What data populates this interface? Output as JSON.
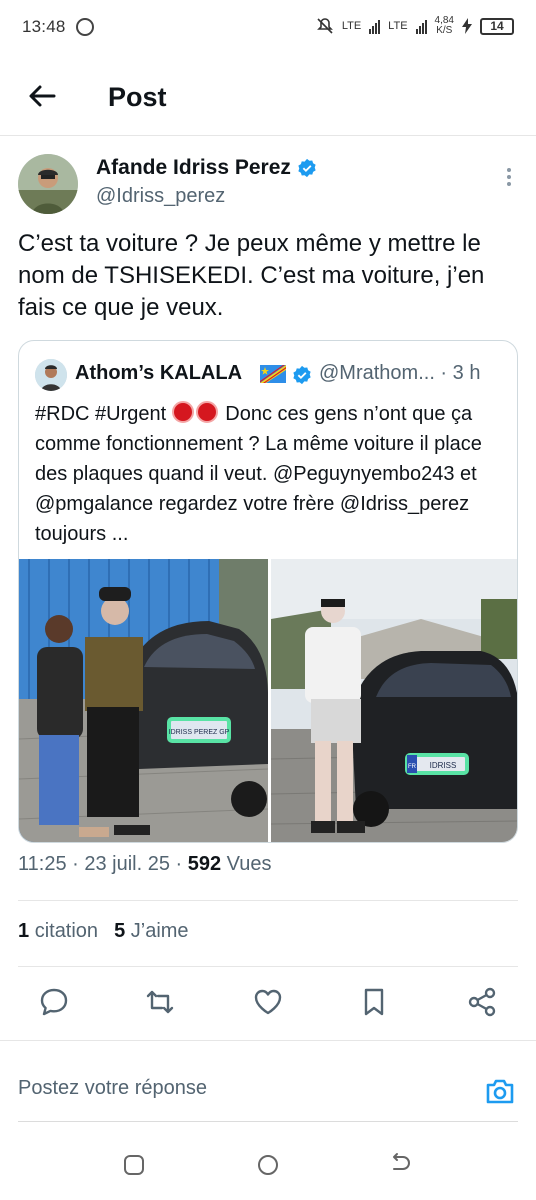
{
  "status_bar": {
    "time": "13:48",
    "net1": "LTE",
    "net2": "LTE",
    "speed_value": "4,84",
    "speed_unit": "K/S",
    "battery": "14"
  },
  "header": {
    "title": "Post"
  },
  "author": {
    "name": "Afande Idriss Perez",
    "handle": "@Idriss_perez"
  },
  "tweet": {
    "text": "C’est ta voiture ? Je peux même y mettre le nom de TSHISEKEDI. C’est ma voiture, j’en fais ce que je veux."
  },
  "quote": {
    "name": "Athom’s KALALA",
    "handle": "@Mrathom... · 3 h",
    "text_hashtags": "#RDC #Urgent",
    "text_body": "Donc ces gens n’ont que ça comme fonctionnement ? La même voiture il place des plaques quand il veut. @Peguynyembo243 et @pmgalance regardez votre frère @Idriss_perez toujours ...",
    "plate1": "IDRISS PEREZ GP",
    "plate2": "IDRISS",
    "plate2_country": "FR"
  },
  "meta": {
    "time_date": "11:25 · 23 juil. 25 · ",
    "views_count": "592",
    "views_label": " Vues"
  },
  "stats": {
    "citations_count": "1",
    "citations_label": "citation",
    "likes_count": "5",
    "likes_label": "J’aime"
  },
  "reply": {
    "placeholder": "Postez votre réponse"
  },
  "colors": {
    "accent": "#1d9bf0",
    "text": "#0f1419",
    "secondary": "#536471",
    "flag_blue": "#2e8ee8"
  },
  "icons": {
    "back": "arrow-left-icon",
    "more": "more-vertical-icon",
    "verified": "verified-badge-icon",
    "reply": "comment-icon",
    "repost": "repost-icon",
    "like": "heart-icon",
    "bookmark": "bookmark-icon",
    "share": "share-icon",
    "camera": "camera-icon"
  }
}
